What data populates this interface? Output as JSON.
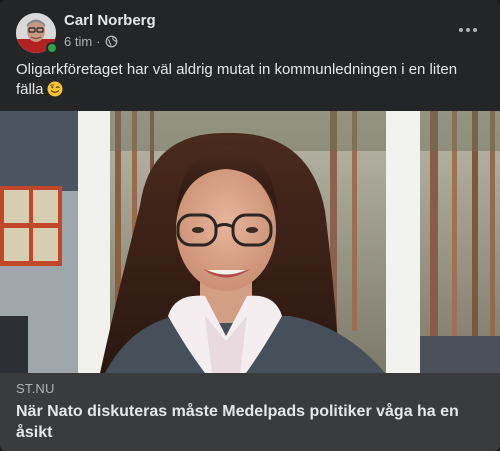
{
  "post": {
    "author": "Carl Norberg",
    "time": "6 tim",
    "separator": "·",
    "privacy_icon": "globe-icon",
    "text": "Oligarkföretaget har väl aldrig mutat in kommunledningen i en liten fälla",
    "emoji": "winking-face-emoji",
    "online": true
  },
  "link": {
    "domain": "ST.NU",
    "title": "När Nato diskuteras måste Medelpads politiker våga ha en åsikt"
  },
  "colors": {
    "card_bg": "#242526",
    "link_footer_bg": "#3a3b3c",
    "online_green": "#31a24c",
    "primary_text": "#e4e6eb",
    "secondary_text": "#b0b3b8"
  }
}
